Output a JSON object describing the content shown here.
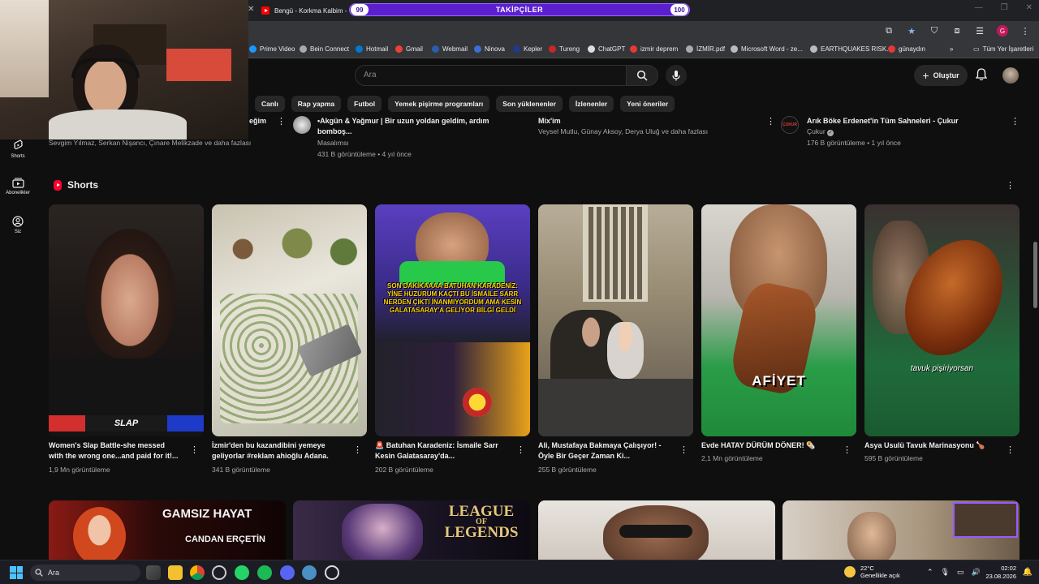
{
  "browser": {
    "tab_title": "Bengü - Korkma Kalbim -",
    "bookmarks": [
      "Prime Video",
      "Bein Connect",
      "Hotmail",
      "Gmail",
      "Webmail",
      "Ninova",
      "Kepler",
      "Tureng",
      "ChatGPT",
      "izmir deprem",
      "İZMİR.pdf",
      "Microsoft Word - ze...",
      "EARTHQUAKES RISK...",
      "günaydın"
    ],
    "bookmarks_all": "Tüm Yer İşaretleri",
    "profile_letter": "G"
  },
  "goal": {
    "label": "TAKİPÇİLER",
    "current": "99",
    "target": "100",
    "progress": 0.99
  },
  "youtube": {
    "search_placeholder": "Ara",
    "create_label": "Oluştur",
    "chips": [
      "Canlı",
      "Rap yapma",
      "Futbol",
      "Yemek pişirme programları",
      "Son yüklenenler",
      "İzlenenler",
      "Yeni öneriler"
    ],
    "sidebar": [
      {
        "label": "Shorts",
        "icon": "shorts-icon"
      },
      {
        "label": "Abonelikler",
        "icon": "subscriptions-icon"
      },
      {
        "label": "Siz",
        "icon": "user-icon"
      }
    ],
    "top_row": {
      "v1": {
        "title_tail": "eğim",
        "meta": "Sevgim Yılmaz, Serkan Nişancı, Çınare Melikzade ve daha fazlası"
      },
      "v2": {
        "title1": "•Akgün & Yağmur | Bir uzun yoldan geldim, ardım",
        "title2": "bomboş...",
        "channel": "Masalımsı",
        "meta": "431 B görüntüleme • 4 yıl önce"
      },
      "v3": {
        "title": "Mix'im",
        "meta": "Veysel Mutlu, Günay Aksoy, Derya Uluğ ve daha fazlası"
      },
      "v4": {
        "title": "Arık Böke Erdenet'in Tüm Sahneleri - Çukur",
        "channel": "Çukur",
        "meta": "176 B görüntüleme • 1 yıl önce",
        "badge": "ÇUKUR"
      }
    },
    "shorts_label": "Shorts",
    "shorts": [
      {
        "title1": "Women's Slap Battle-she messed",
        "title2": "with the wrong one...and paid for it!...",
        "views": "1,9 Mn görüntüleme",
        "overlay": "SLAP"
      },
      {
        "title1": "İzmir'den bu kazandibini yemeye",
        "title2": "geliyorlar #reklam ahioğlu Adana.",
        "views": "341 B görüntüleme",
        "overlay": ""
      },
      {
        "title1": "🚨 Batuhan Karadeniz: İsmaile Sarr",
        "title2": "Kesin Galatasaray'da...",
        "views": "202 B görüntüleme",
        "overlay": "SON DAKİKAAAA BATUHAN KARADENİZ: YİNE HUZURUM KAÇTI BU İSMAİLE SARR NERDEN ÇIKTI İNANMIYORDUM AMA KESİN GALATASARAY'A GELİYOR BİLGİ GELDİ"
      },
      {
        "title1": "Ali, Mustafaya Bakmaya Çalışıyor! -",
        "title2": "Öyle Bir Geçer Zaman Ki...",
        "views": "255 B görüntüleme",
        "overlay": ""
      },
      {
        "title1": "Evde HATAY DÜRÜM DÖNER! 🌯",
        "title2": "",
        "views": "2,1 Mn görüntüleme",
        "overlay": "AFİYET"
      },
      {
        "title1": "Asya Usulü Tavuk Marinasyonu 🍗",
        "title2": "",
        "views": "595 B görüntüleme",
        "overlay": "tavuk pişiriyorsan"
      }
    ],
    "bottom_row": [
      {
        "line1": "GAMSIZ HAYAT",
        "line2": "CANDAN ERÇETİN"
      },
      {
        "line1": "LEAGUE",
        "line2": "OF",
        "line3": "LEGENDS"
      }
    ]
  },
  "taskbar": {
    "search": "Ara",
    "weather_temp": "22°C",
    "weather_desc": "Genellikle açık",
    "time": "02:02",
    "date": "23.08.2026"
  }
}
